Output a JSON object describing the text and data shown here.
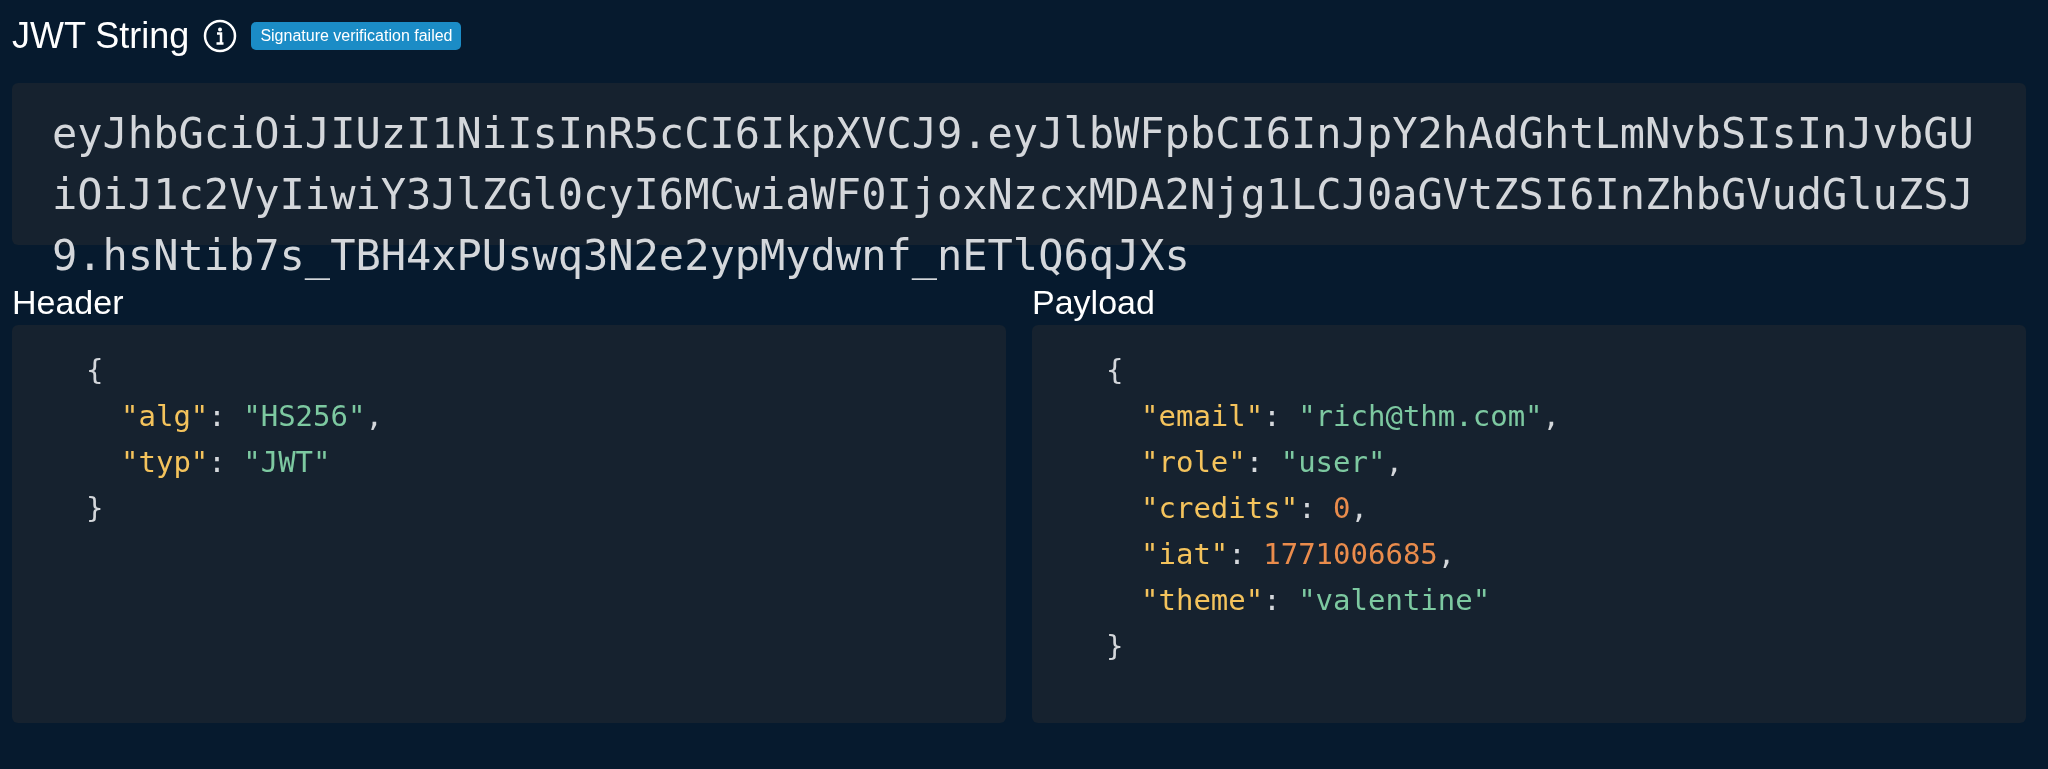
{
  "jwt": {
    "title": "JWT String",
    "badge": "Signature verification failed",
    "token": "eyJhbGciOiJIUzI1NiIsInR5cCI6IkpXVCJ9.eyJlbWFpbCI6InJpY2hAdGhtLmNvbSIsInJvbGUiOiJ1c2VyIiwiY3JlZGl0cyI6MCwiaWF0IjoxNzcxMDA2Njg1LCJ0aGVtZSI6InZhbGVudGluZSJ9.hsNtib7s_TBH4xPUswq3N2e2ypMydwnf_nETlQ6qJXs"
  },
  "panels": [
    {
      "title": "Header",
      "open": "{",
      "close": "}",
      "fields": [
        {
          "key": "\"alg\"",
          "colon": ":",
          "value": "\"HS256\"",
          "kind": "string",
          "tail": ","
        },
        {
          "key": "\"typ\"",
          "colon": ":",
          "value": "\"JWT\"",
          "kind": "string"
        }
      ]
    },
    {
      "title": "Payload",
      "open": "{",
      "close": "}",
      "fields": [
        {
          "key": "\"email\"",
          "colon": ":",
          "value": "\"rich@thm.com\"",
          "kind": "string",
          "tail": ","
        },
        {
          "key": "\"role\"",
          "colon": ":",
          "value": "\"user\"",
          "kind": "string",
          "tail": ","
        },
        {
          "key": "\"credits\"",
          "colon": ":",
          "value": "0",
          "kind": "number",
          "tail": ","
        },
        {
          "key": "\"iat\"",
          "colon": ":",
          "value": "1771006685",
          "kind": "number",
          "tail": ","
        },
        {
          "key": "\"theme\"",
          "colon": ":",
          "value": "\"valentine\"",
          "kind": "string"
        }
      ]
    }
  ]
}
